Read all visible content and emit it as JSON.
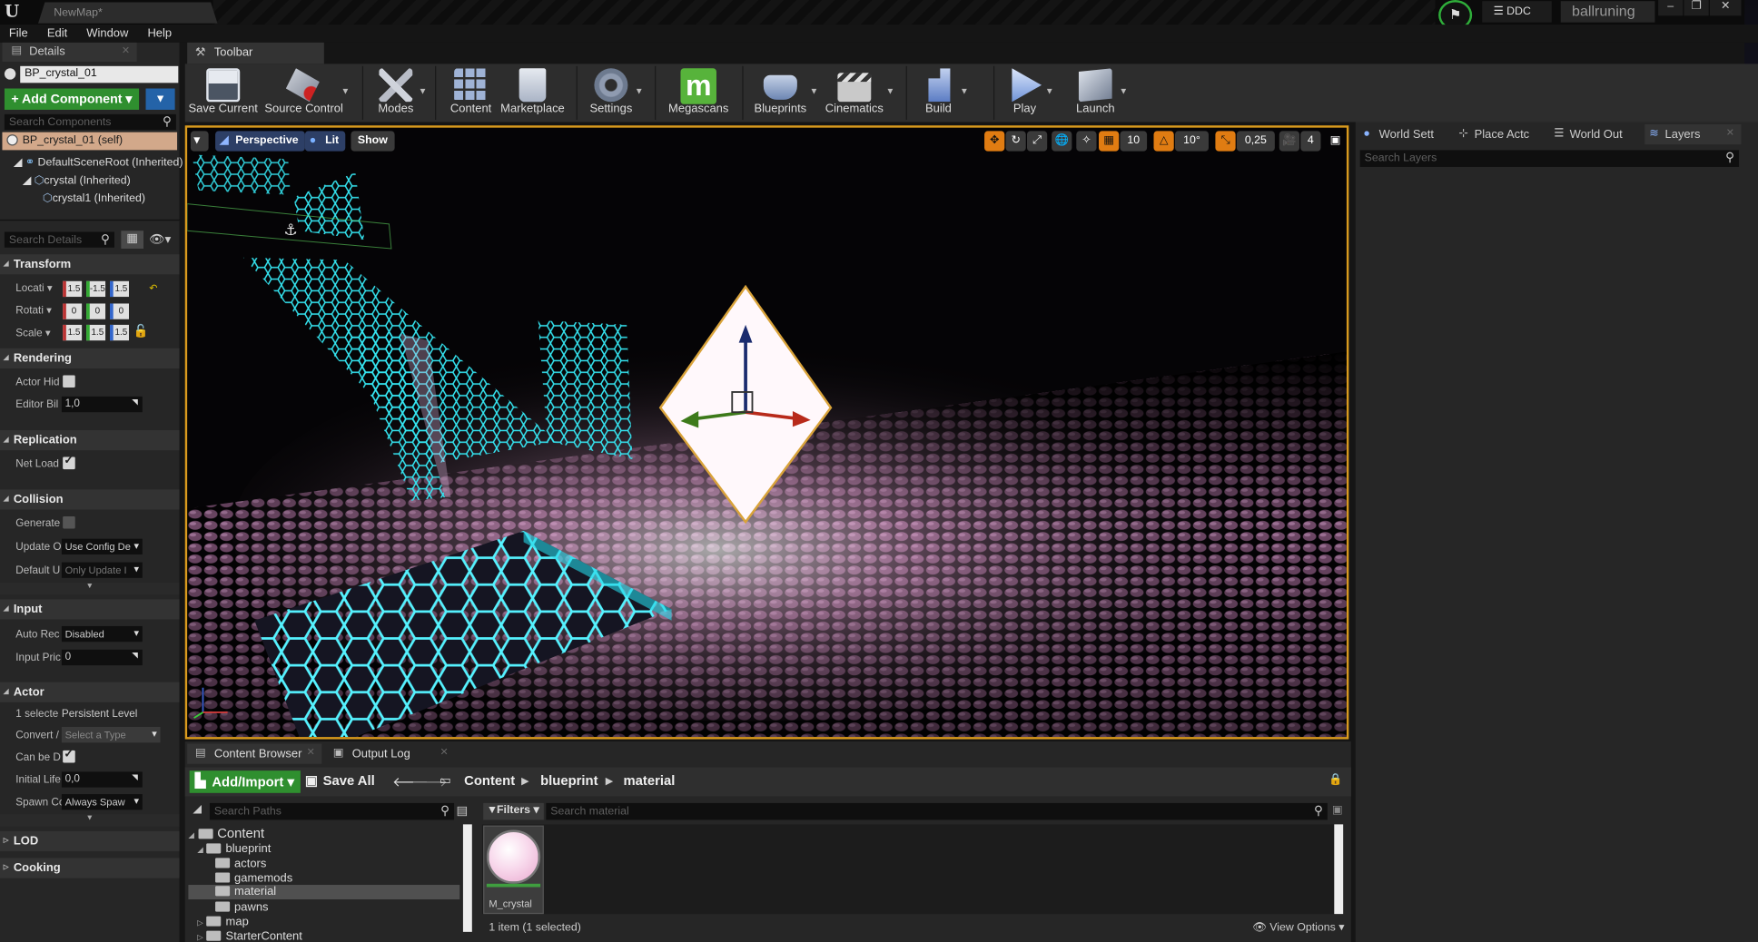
{
  "window": {
    "map_tab": "NewMap*",
    "ddc": "DDC",
    "project": "ballruning",
    "controls": [
      "–",
      "❐",
      "✕"
    ]
  },
  "menu": [
    "File",
    "Edit",
    "Window",
    "Help"
  ],
  "details": {
    "tab": "Details",
    "blueprint_name": "BP_crystal_01",
    "add_component": "+ Add Component ▾",
    "search_components": "Search Components",
    "components": [
      "BP_crystal_01 (self)",
      "DefaultSceneRoot (Inherited)",
      "crystal (Inherited)",
      "crystal1 (Inherited)"
    ],
    "search_details": "Search Details",
    "sections": {
      "transform": "Transform",
      "rendering": "Rendering",
      "replication": "Replication",
      "collision": "Collision",
      "input": "Input",
      "actor": "Actor",
      "lod": "LOD",
      "cooking": "Cooking"
    },
    "props": {
      "location": "Locati ▾",
      "rotation": "Rotati ▾",
      "scale": "Scale ▾",
      "actor_hidden": "Actor Hid",
      "editor_billboard": "Editor Bil",
      "editor_billboard_value": "1,0",
      "net_load": "Net Load",
      "generate": "Generate",
      "update_overlaps": "Update O",
      "update_overlaps_value": "Use Config De",
      "default_update": "Default U",
      "default_update_value": "Only Update I",
      "auto_receive": "Auto Rec",
      "auto_receive_value": "Disabled",
      "input_priority": "Input Pric",
      "input_priority_value": "0",
      "selected": "1 selecte",
      "selected_value": "Persistent Level",
      "convert": "Convert /",
      "convert_value": "Select a Type",
      "can_be_damaged": "Can be D",
      "initial_life": "Initial Life",
      "initial_life_value": "0,0",
      "spawn_collision": "Spawn Cc",
      "spawn_collision_value": "Always Spaw"
    }
  },
  "toolbar": {
    "tab": "Toolbar",
    "buttons": [
      {
        "label": "Save Current",
        "color": "#d0d6e0"
      },
      {
        "label": "Source Control",
        "color": "#b8bec8"
      },
      {
        "label": "Modes",
        "color": "#c8ccd4"
      },
      {
        "label": "Content",
        "color": "#9fb3d6"
      },
      {
        "label": "Marketplace",
        "color": "#c7cfdc"
      },
      {
        "label": "Settings",
        "color": "#8f9bb0"
      },
      {
        "label": "Megascans",
        "color": "#57b33b"
      },
      {
        "label": "Blueprints",
        "color": "#8ea6c9"
      },
      {
        "label": "Cinematics",
        "color": "#d8d8d8"
      },
      {
        "label": "Build",
        "color": "#8aa5d6"
      },
      {
        "label": "Play",
        "color": "#9bb8ea"
      },
      {
        "label": "Launch",
        "color": "#aab4c4"
      }
    ]
  },
  "viewport": {
    "perspective": "Perspective",
    "lit": "Lit",
    "show": "Show",
    "grid_snap": "10",
    "rot_snap": "10°",
    "scale_snap": "0,25",
    "cam_speed": "4"
  },
  "right_panel": {
    "tabs": [
      "World Sett",
      "Place Actc",
      "World Out",
      "Layers"
    ],
    "search_layers": "Search Layers"
  },
  "content_browser": {
    "tabs": [
      "Content Browser",
      "Output Log"
    ],
    "add_import": "Add/Import ▾",
    "save_all": "Save All",
    "crumbs": [
      "Content",
      "blueprint",
      "material"
    ],
    "search_paths": "Search Paths",
    "filters": "Filters ▾",
    "search_material": "Search material",
    "tree": [
      "Content",
      "blueprint",
      "actors",
      "gamemods",
      "material",
      "pawns",
      "map",
      "StarterContent"
    ],
    "asset": "M_crystal",
    "item_count": "1 item (1 selected)",
    "view_options": "View Options ▾"
  },
  "colors": {
    "selection_border": "#d99a1e",
    "green_button": "#2f8f2f",
    "hex_glow": "#30e6f0"
  }
}
